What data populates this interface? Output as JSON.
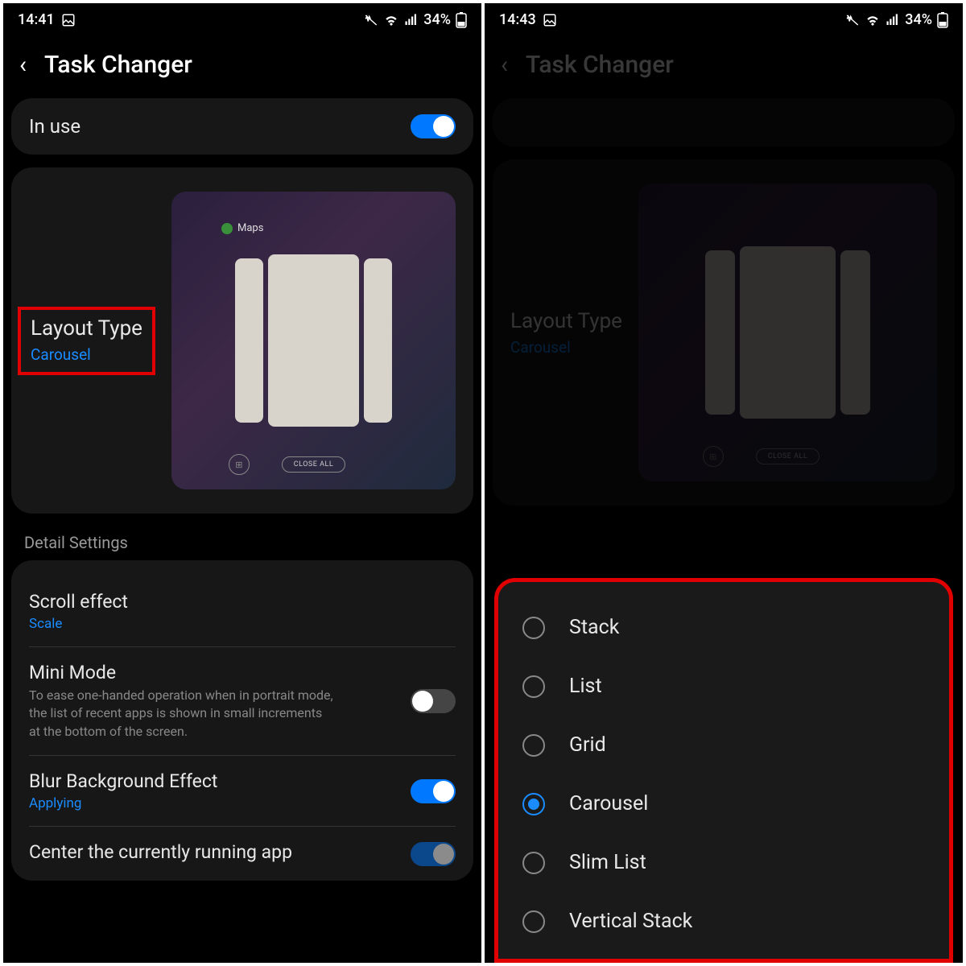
{
  "left": {
    "status": {
      "time": "14:41",
      "battery": "34%"
    },
    "title": "Task Changer",
    "in_use_label": "In use",
    "layout_type_label": "Layout Type",
    "layout_type_value": "Carousel",
    "preview_app": "Maps",
    "preview_close": "CLOSE ALL",
    "detail_header": "Detail Settings",
    "scroll_effect": {
      "title": "Scroll effect",
      "value": "Scale"
    },
    "mini_mode": {
      "title": "Mini Mode",
      "desc": "To ease one-handed operation when in portrait mode, the list of recent apps is shown in small increments at the bottom of the screen."
    },
    "blur": {
      "title": "Blur Background Effect",
      "value": "Applying"
    },
    "center": {
      "title": "Center the currently running app"
    }
  },
  "right": {
    "status": {
      "time": "14:43",
      "battery": "34%"
    },
    "title": "Task Changer",
    "layout_type_label": "Layout Type",
    "layout_type_value": "Carousel",
    "options": [
      "Stack",
      "List",
      "Grid",
      "Carousel",
      "Slim List",
      "Vertical Stack"
    ],
    "selected": "Carousel"
  }
}
